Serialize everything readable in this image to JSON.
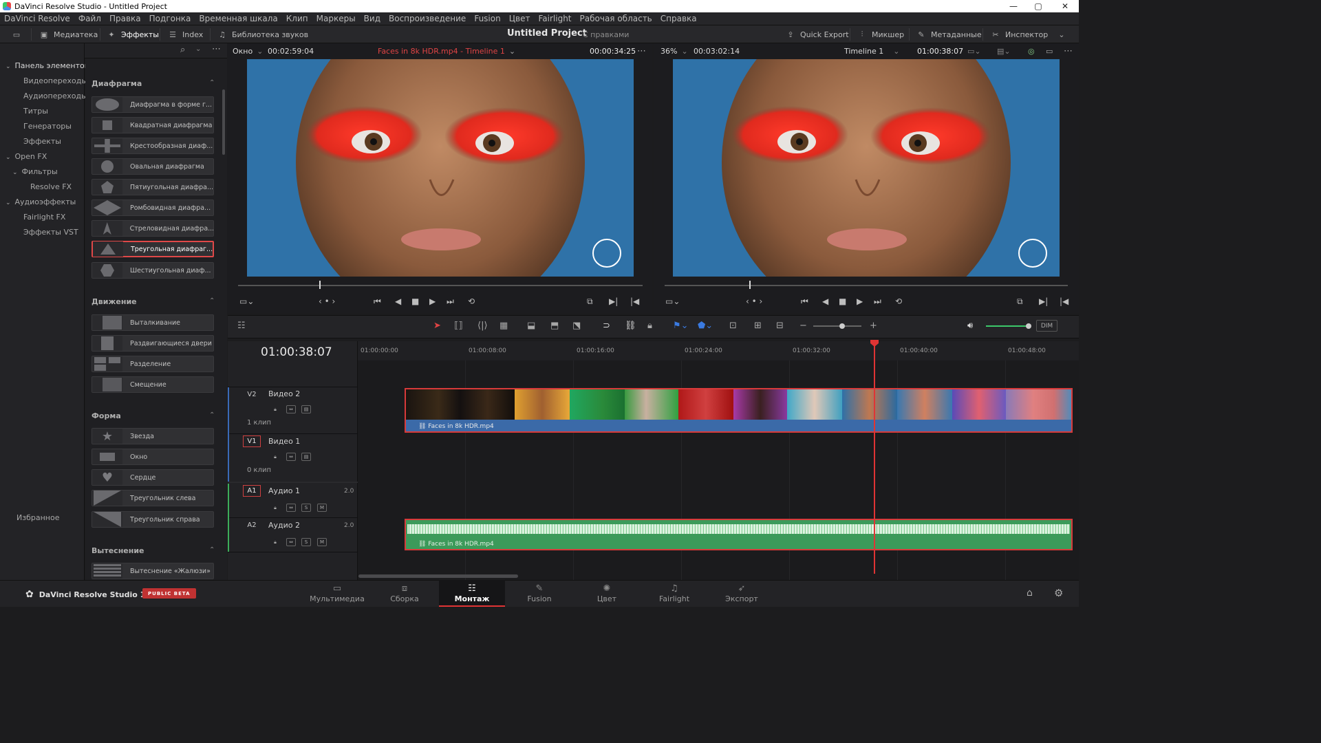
{
  "window": {
    "title": "DaVinci Resolve Studio - Untitled Project",
    "min": "—",
    "max": "▢",
    "close": "✕"
  },
  "menu": [
    "DaVinci Resolve",
    "Файл",
    "Правка",
    "Подгонка",
    "Временная шкала",
    "Клип",
    "Маркеры",
    "Вид",
    "Воспроизведение",
    "Fusion",
    "Цвет",
    "Fairlight",
    "Рабочая область",
    "Справка"
  ],
  "toolbar": {
    "media": "Медиатека",
    "effects": "Эффекты",
    "index": "Index",
    "sound": "Библиотека звуков",
    "project_title": "Untitled Project",
    "project_sub": "С правками",
    "quick_export": "Quick Export",
    "mixer": "Микшер",
    "metadata": "Метаданные",
    "inspector": "Инспектор"
  },
  "sidebar": {
    "root": "Панель элементов",
    "items": [
      "Видеопереходы",
      "Аудиопереходы",
      "Титры",
      "Генераторы",
      "Эффекты"
    ],
    "openfx": "Open FX",
    "filters": "Фильтры",
    "resolvefx": "Resolve FX",
    "audiofx": "Аудиоэффекты",
    "fairlightfx": "Fairlight FX",
    "vst": "Эффекты VST",
    "favorites": "Избранное"
  },
  "effects": {
    "iris_title": "Диафрагма",
    "iris": [
      "Диафрагма в форме г...",
      "Квадратная диафрагма",
      "Крестообразная диаф...",
      "Овальная диафрагма",
      "Пятиугольная диафра...",
      "Ромбовидная диафра...",
      "Стреловидная диафра...",
      "Треугольная диафраг...",
      "Шестиугольная диаф..."
    ],
    "motion_title": "Движение",
    "motion": [
      "Выталкивание",
      "Раздвигающиеся двери",
      "Разделение",
      "Смещение"
    ],
    "shape_title": "Форма",
    "shape": [
      "Звезда",
      "Окно",
      "Сердце",
      "Треугольник слева",
      "Треугольник справа"
    ],
    "wipe_title": "Вытеснение",
    "wipe": [
      "Вытеснение «Жалюзи»"
    ]
  },
  "viewer_left": {
    "mode": "Окно",
    "duration": "00:02:59:04",
    "clip": "Faces in 8k HDR.mp4 - Timeline 1",
    "tc": "00:00:34:25",
    "playhead": 0.2
  },
  "viewer_right": {
    "zoom": "36%",
    "duration": "00:03:02:14",
    "timeline": "Timeline 1",
    "tc": "01:00:38:07",
    "playhead": 0.21
  },
  "timeline": {
    "timecode": "01:00:38:07",
    "ruler": [
      "01:00:00:00",
      "01:00:08:00",
      "01:00:16:00",
      "01:00:24:00",
      "01:00:32:00",
      "01:00:40:00",
      "01:00:48:00"
    ],
    "dim": "DIM",
    "tracks": {
      "v2": {
        "id": "V2",
        "name": "Видео 2",
        "sub": "1 клип"
      },
      "v1": {
        "id": "V1",
        "name": "Видео 1",
        "sub": "0 клип"
      },
      "a1": {
        "id": "A1",
        "name": "Аудио 1",
        "level": "2.0",
        "s": "S",
        "m": "M"
      },
      "a2": {
        "id": "A2",
        "name": "Аудио 2",
        "level": "2.0",
        "s": "S",
        "m": "M"
      }
    },
    "clip_name": "Faces in 8k HDR.mp4"
  },
  "pages": [
    "Мультимедиа",
    "Сборка",
    "Монтаж",
    "Fusion",
    "Цвет",
    "Fairlight",
    "Экспорт"
  ],
  "active_page": "Монтаж",
  "brand": {
    "name": "DaVinci Resolve Studio 19",
    "badge": "PUBLIC BETA"
  },
  "colors": {
    "accent": "#e03434",
    "video_clip": "#3b6aa8",
    "audio_clip": "#3c9a5a",
    "background": "#2d6fa6"
  }
}
